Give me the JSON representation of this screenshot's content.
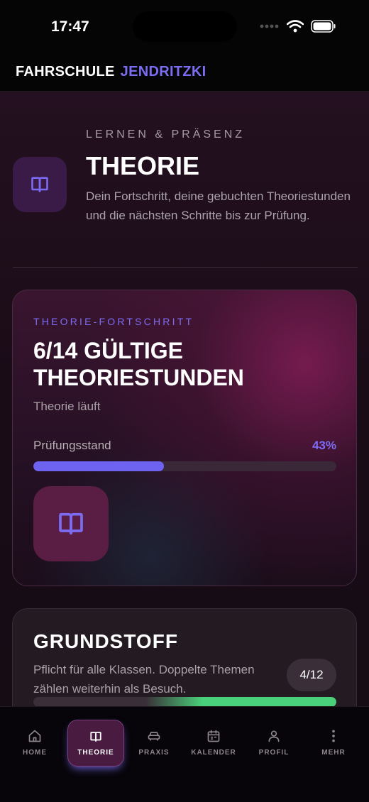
{
  "status_bar": {
    "time": "17:47"
  },
  "header": {
    "brand_part1": "FAHRSCHULE",
    "brand_part2": "JENDRITZKI"
  },
  "hero": {
    "eyebrow": "LERNEN & PRÄSENZ",
    "title": "THEORIE",
    "description": "Dein Fortschritt, deine gebuchten Theoriestunden und die nächsten Schritte bis zur Prüfung.",
    "icon": "book-icon"
  },
  "progress_card": {
    "eyebrow": "THEORIE-FORTSCHRITT",
    "title": "6/14 GÜLTIGE THEORIESTUNDEN",
    "subtitle": "Theorie läuft",
    "progress_label": "Prüfungsstand",
    "progress_percent_text": "43%",
    "progress_value": 0.43,
    "icon": "book-icon"
  },
  "grundstoff_card": {
    "title": "GRUNDSTOFF",
    "description": "Pflicht für alle Klassen. Doppelte Themen zählen weiterhin als Besuch.",
    "badge": "4/12",
    "progress_value": 0.33
  },
  "bottom_nav": {
    "items": [
      {
        "label": "HOME",
        "icon": "home-icon",
        "active": false
      },
      {
        "label": "THEORIE",
        "icon": "book-icon",
        "active": true
      },
      {
        "label": "PRAXIS",
        "icon": "car-icon",
        "active": false
      },
      {
        "label": "KALENDER",
        "icon": "calendar-icon",
        "active": false
      },
      {
        "label": "PROFIL",
        "icon": "person-icon",
        "active": false
      },
      {
        "label": "MEHR",
        "icon": "more-vertical-icon",
        "active": false
      }
    ]
  },
  "colors": {
    "accent": "#7c6cf2",
    "success": "#4ad07a",
    "background": "#140b12"
  }
}
